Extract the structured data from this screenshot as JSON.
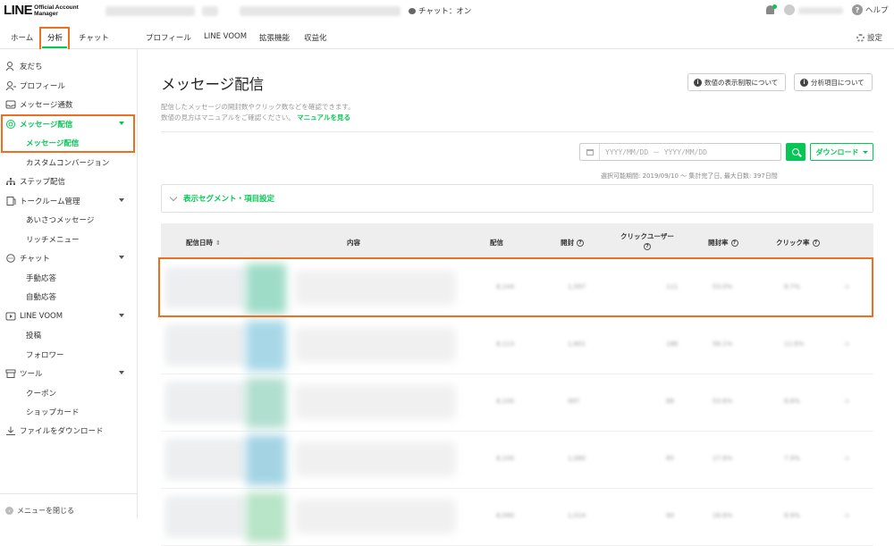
{
  "header": {
    "logo_main": "LINE",
    "logo_sub_1": "Official Account",
    "logo_sub_2": "Manager",
    "chat_status": "チャット：オン",
    "help_label": "ヘルプ"
  },
  "nav": {
    "items": [
      {
        "label": "ホーム"
      },
      {
        "label": "分析"
      },
      {
        "label": "チャット"
      },
      {
        "label": "プロフィール"
      },
      {
        "label": "LINE VOOM"
      },
      {
        "label": "拡張機能"
      },
      {
        "label": "収益化"
      }
    ],
    "active": "分析",
    "settings_label": "設定"
  },
  "sidebar": {
    "items": [
      {
        "label": "友だち",
        "icon": "person-icon"
      },
      {
        "label": "プロフィール",
        "icon": "profile-icon"
      },
      {
        "label": "メッセージ通数",
        "icon": "inbox-icon"
      },
      {
        "label": "メッセージ配信",
        "icon": "broadcast-icon",
        "active": true,
        "expanded": true
      },
      {
        "label": "メッセージ配信",
        "sub": true,
        "active": true
      },
      {
        "label": "カスタムコンバージョン",
        "sub": true
      },
      {
        "label": "ステップ配信",
        "icon": "hierarchy-icon"
      },
      {
        "label": "トークルーム管理",
        "icon": "document-icon",
        "expandable": true
      },
      {
        "label": "あいさつメッセージ",
        "sub": true
      },
      {
        "label": "リッチメニュー",
        "sub": true
      },
      {
        "label": "チャット",
        "icon": "chat-icon",
        "expandable": true
      },
      {
        "label": "手動応答",
        "sub": true
      },
      {
        "label": "自動応答",
        "sub": true
      },
      {
        "label": "LINE VOOM",
        "icon": "voom-icon",
        "expandable": true
      },
      {
        "label": "投稿",
        "sub": true
      },
      {
        "label": "フォロワー",
        "sub": true
      },
      {
        "label": "ツール",
        "icon": "store-icon",
        "expandable": true
      },
      {
        "label": "クーポン",
        "sub": true
      },
      {
        "label": "ショップカード",
        "sub": true
      },
      {
        "label": "ファイルをダウンロード",
        "icon": "download-icon"
      }
    ],
    "collapse_label": "メニューを閉じる"
  },
  "main": {
    "title": "メッセージ配信",
    "desc_line1": "配信したメッセージの開封数やクリック数などを確認できます。",
    "desc_line2": "数値の見方はマニュアルをご確認ください。",
    "manual_link": "マニュアルを見る",
    "btn_limits": "数値の表示制限について",
    "btn_items": "分析項目について",
    "date_placeholder": "YYYY/MM/DD － YYYY/MM/DD",
    "download_label": "ダウンロード",
    "range_note": "選択可能期間: 2019/09/10 〜 集計完了日, 最大日数: 397日間",
    "segment_label": "表示セグメント・項目設定",
    "columns": [
      "配信日時",
      "内容",
      "配信",
      "開封",
      "クリックユーザー",
      "開封率",
      "クリック率"
    ],
    "rows": [
      {
        "deliveries": "8,144",
        "opens": "1,597",
        "click_users": "111",
        "open_rate": "53.0%",
        "click_rate": "8.7%",
        "thumb_color": "#9fdcc8"
      },
      {
        "deliveries": "8,113",
        "opens": "1,601",
        "click_users": "186",
        "open_rate": "58.1%",
        "click_rate": "11.6%",
        "thumb_color": "#a8d8e8"
      },
      {
        "deliveries": "8,100",
        "opens": "997",
        "click_users": "88",
        "open_rate": "53.6%",
        "click_rate": "8.8%",
        "thumb_color": "#b0dfd0"
      },
      {
        "deliveries": "8,100",
        "opens": "1,080",
        "click_users": "85",
        "open_rate": "17.6%",
        "click_rate": "7.9%",
        "thumb_color": "#a4d4e4"
      },
      {
        "deliveries": "8,090",
        "opens": "1,014",
        "click_users": "90",
        "open_rate": "16.6%",
        "click_rate": "8.9%",
        "thumb_color": "#b8e4c8"
      }
    ]
  }
}
